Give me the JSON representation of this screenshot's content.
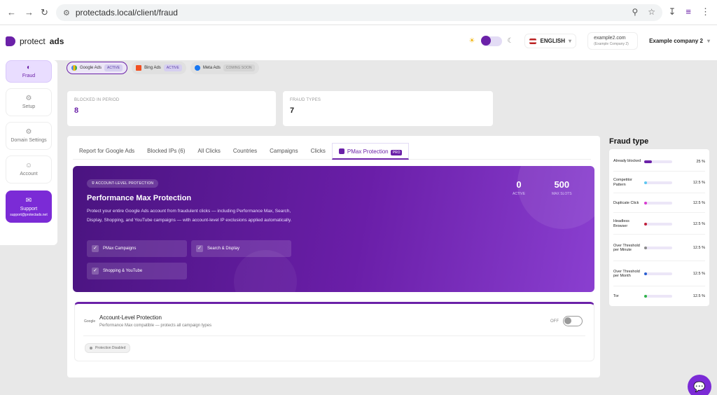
{
  "browser": {
    "url": "protectads.local/client/fraud"
  },
  "header": {
    "brand_light": "protect",
    "brand_bold": "ads",
    "language": "ENGLISH",
    "account_email": "example2.com",
    "account_sub": "(Example Company 2)",
    "company": "Example company 2"
  },
  "sidebar": {
    "items": [
      {
        "label": "Fraud",
        "icon": "chart-icon"
      },
      {
        "label": "Setup",
        "icon": "gear-icon"
      },
      {
        "label": "Domain Settings",
        "icon": "settings-icon"
      },
      {
        "label": "Account",
        "icon": "user-icon"
      }
    ],
    "support": {
      "label": "Support",
      "email": "support@protectads.net"
    }
  },
  "platforms": [
    {
      "name": "Google Ads",
      "badge": "ACTIVE"
    },
    {
      "name": "Bing Ads",
      "badge": "ACTIVE"
    },
    {
      "name": "Meta Ads",
      "badge": "COMING SOON"
    }
  ],
  "stats": {
    "blocked_label": "BLOCKED IN PERIOD",
    "blocked_value": "8",
    "fraud_types_label": "FRAUD TYPES",
    "fraud_types_value": "7"
  },
  "tabs": [
    "Report for Google Ads",
    "Blocked IPs (6)",
    "All Clicks",
    "Countries",
    "Campaigns",
    "Clicks",
    "PMax Protection"
  ],
  "tab_pro_badge": "PRO",
  "hero": {
    "badge": "ACCOUNT-LEVEL PROTECTION",
    "title": "Performance Max Protection",
    "description": "Protect your entire Google Ads account from fraudulent clicks — including Performance Max, Search, Display, Shopping, and YouTube campaigns — with account-level IP exclusions applied automatically.",
    "features": [
      "PMax Campaigns",
      "Search & Display",
      "Shopping & YouTube"
    ],
    "active_value": "0",
    "active_label": "ACTIVE",
    "slots_value": "500",
    "slots_label": "MAX SLOTS"
  },
  "account_protection": {
    "logo_text": "Google",
    "title": "Account-Level Protection",
    "subtitle": "Performance Max compatible — protects all campaign types",
    "toggle_label": "OFF",
    "status": "Protection Disabled"
  },
  "fraud_type": {
    "title": "Fraud type",
    "rows": [
      {
        "label": "Already blocked",
        "pct": "25 %",
        "fraction": 0.25,
        "color": "#6b21a8"
      },
      {
        "label": "Competitor Pattern",
        "pct": "12.5 %",
        "fraction": 0.125,
        "color": "#5ec8f0"
      },
      {
        "label": "Duplicate Click",
        "pct": "12.5 %",
        "fraction": 0.125,
        "color": "#d93bd0"
      },
      {
        "label": "Headless Browser",
        "pct": "12.5 %",
        "fraction": 0.125,
        "color": "#c0203a"
      },
      {
        "label": "Over Threshold per Minute",
        "pct": "12.5 %",
        "fraction": 0.125,
        "color": "#8a8a8a"
      },
      {
        "label": "Over Threshold per Month",
        "pct": "12.5 %",
        "fraction": 0.125,
        "color": "#2a5fd0"
      },
      {
        "label": "Tor",
        "pct": "12.5 %",
        "fraction": 0.125,
        "color": "#2fb34a"
      }
    ]
  }
}
